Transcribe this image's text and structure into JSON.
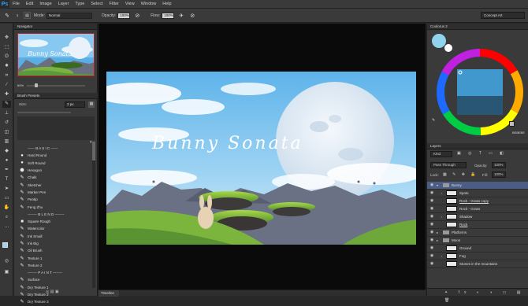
{
  "menu": [
    "File",
    "Edit",
    "Image",
    "Layer",
    "Type",
    "Select",
    "Filter",
    "View",
    "Window",
    "Help"
  ],
  "app_logo": "Ps",
  "options": {
    "brush_size": "3",
    "mode_label": "Mode:",
    "mode_value": "Normal",
    "opacity_label": "Opacity:",
    "opacity_value": "100%",
    "flow_label": "Flow:",
    "flow_value": "100%",
    "workspace": "Concept Art"
  },
  "navigator": {
    "tab": "Navigator",
    "zoom": "60%"
  },
  "brush_presets": {
    "tab": "Brush Presets",
    "size_label": "Size:",
    "size_value": "3 px",
    "items": [
      {
        "label": "------ B A S I C ------",
        "icon": ""
      },
      {
        "label": "Hard Round",
        "icon": "●"
      },
      {
        "label": "Soft Round",
        "icon": "●"
      },
      {
        "label": "Hexagon",
        "icon": "⬢"
      },
      {
        "label": "Chalk",
        "icon": "✎"
      },
      {
        "label": "Sketcher",
        "icon": "✎"
      },
      {
        "label": "Marker Pen",
        "icon": "✎"
      },
      {
        "label": "Pentip",
        "icon": "✎"
      },
      {
        "label": "Feng Zhu",
        "icon": "✎"
      },
      {
        "label": "-------- B L E N D --------",
        "icon": ""
      },
      {
        "label": "Square Rough",
        "icon": "■"
      },
      {
        "label": "Watercolor",
        "icon": "✎"
      },
      {
        "label": "Ink Small",
        "icon": "✎"
      },
      {
        "label": "Ink Big",
        "icon": "✎"
      },
      {
        "label": "Oil Brush",
        "icon": "✎"
      },
      {
        "label": "Texture 1",
        "icon": "✎"
      },
      {
        "label": "Texture 2",
        "icon": "✎"
      },
      {
        "label": "-------- P A I N T --------",
        "icon": ""
      },
      {
        "label": "Surface",
        "icon": "✎"
      },
      {
        "label": "Dry Texture 1",
        "icon": "✎"
      },
      {
        "label": "Dry Texture 2",
        "icon": "✎"
      },
      {
        "label": "Dry Texture 3",
        "icon": "✎"
      },
      {
        "label": "Scratches",
        "icon": "✎"
      }
    ]
  },
  "artwork": {
    "title": "Bunny Sonata"
  },
  "timeline": {
    "tab": "Timeline"
  },
  "coolorus": {
    "tab": "Coolorus 2",
    "hex": "BEBEBE",
    "foreground": "#8fd3ee"
  },
  "layers": {
    "tab": "Layers",
    "kind": "Kind",
    "blend": "Pass Through",
    "opacity_label": "Opacity:",
    "opacity_value": "100%",
    "lock_label": "Lock:",
    "fill_label": "Fill:",
    "fill_value": "100%",
    "items": [
      {
        "name": "Bunny",
        "type": "group",
        "selected": true
      },
      {
        "name": "Spots",
        "type": "layer"
      },
      {
        "name": "Rock - Grass copy",
        "type": "layer"
      },
      {
        "name": "Rock - Grass",
        "type": "layer"
      },
      {
        "name": "Shadow",
        "type": "layer"
      },
      {
        "name": "Rock",
        "type": "layer"
      },
      {
        "name": "Platforms",
        "type": "group"
      },
      {
        "name": "Moon",
        "type": "group"
      },
      {
        "name": "Ground",
        "type": "layer"
      },
      {
        "name": "Fog",
        "type": "layer"
      },
      {
        "name": "Stones in the mountains",
        "type": "layer"
      }
    ]
  }
}
